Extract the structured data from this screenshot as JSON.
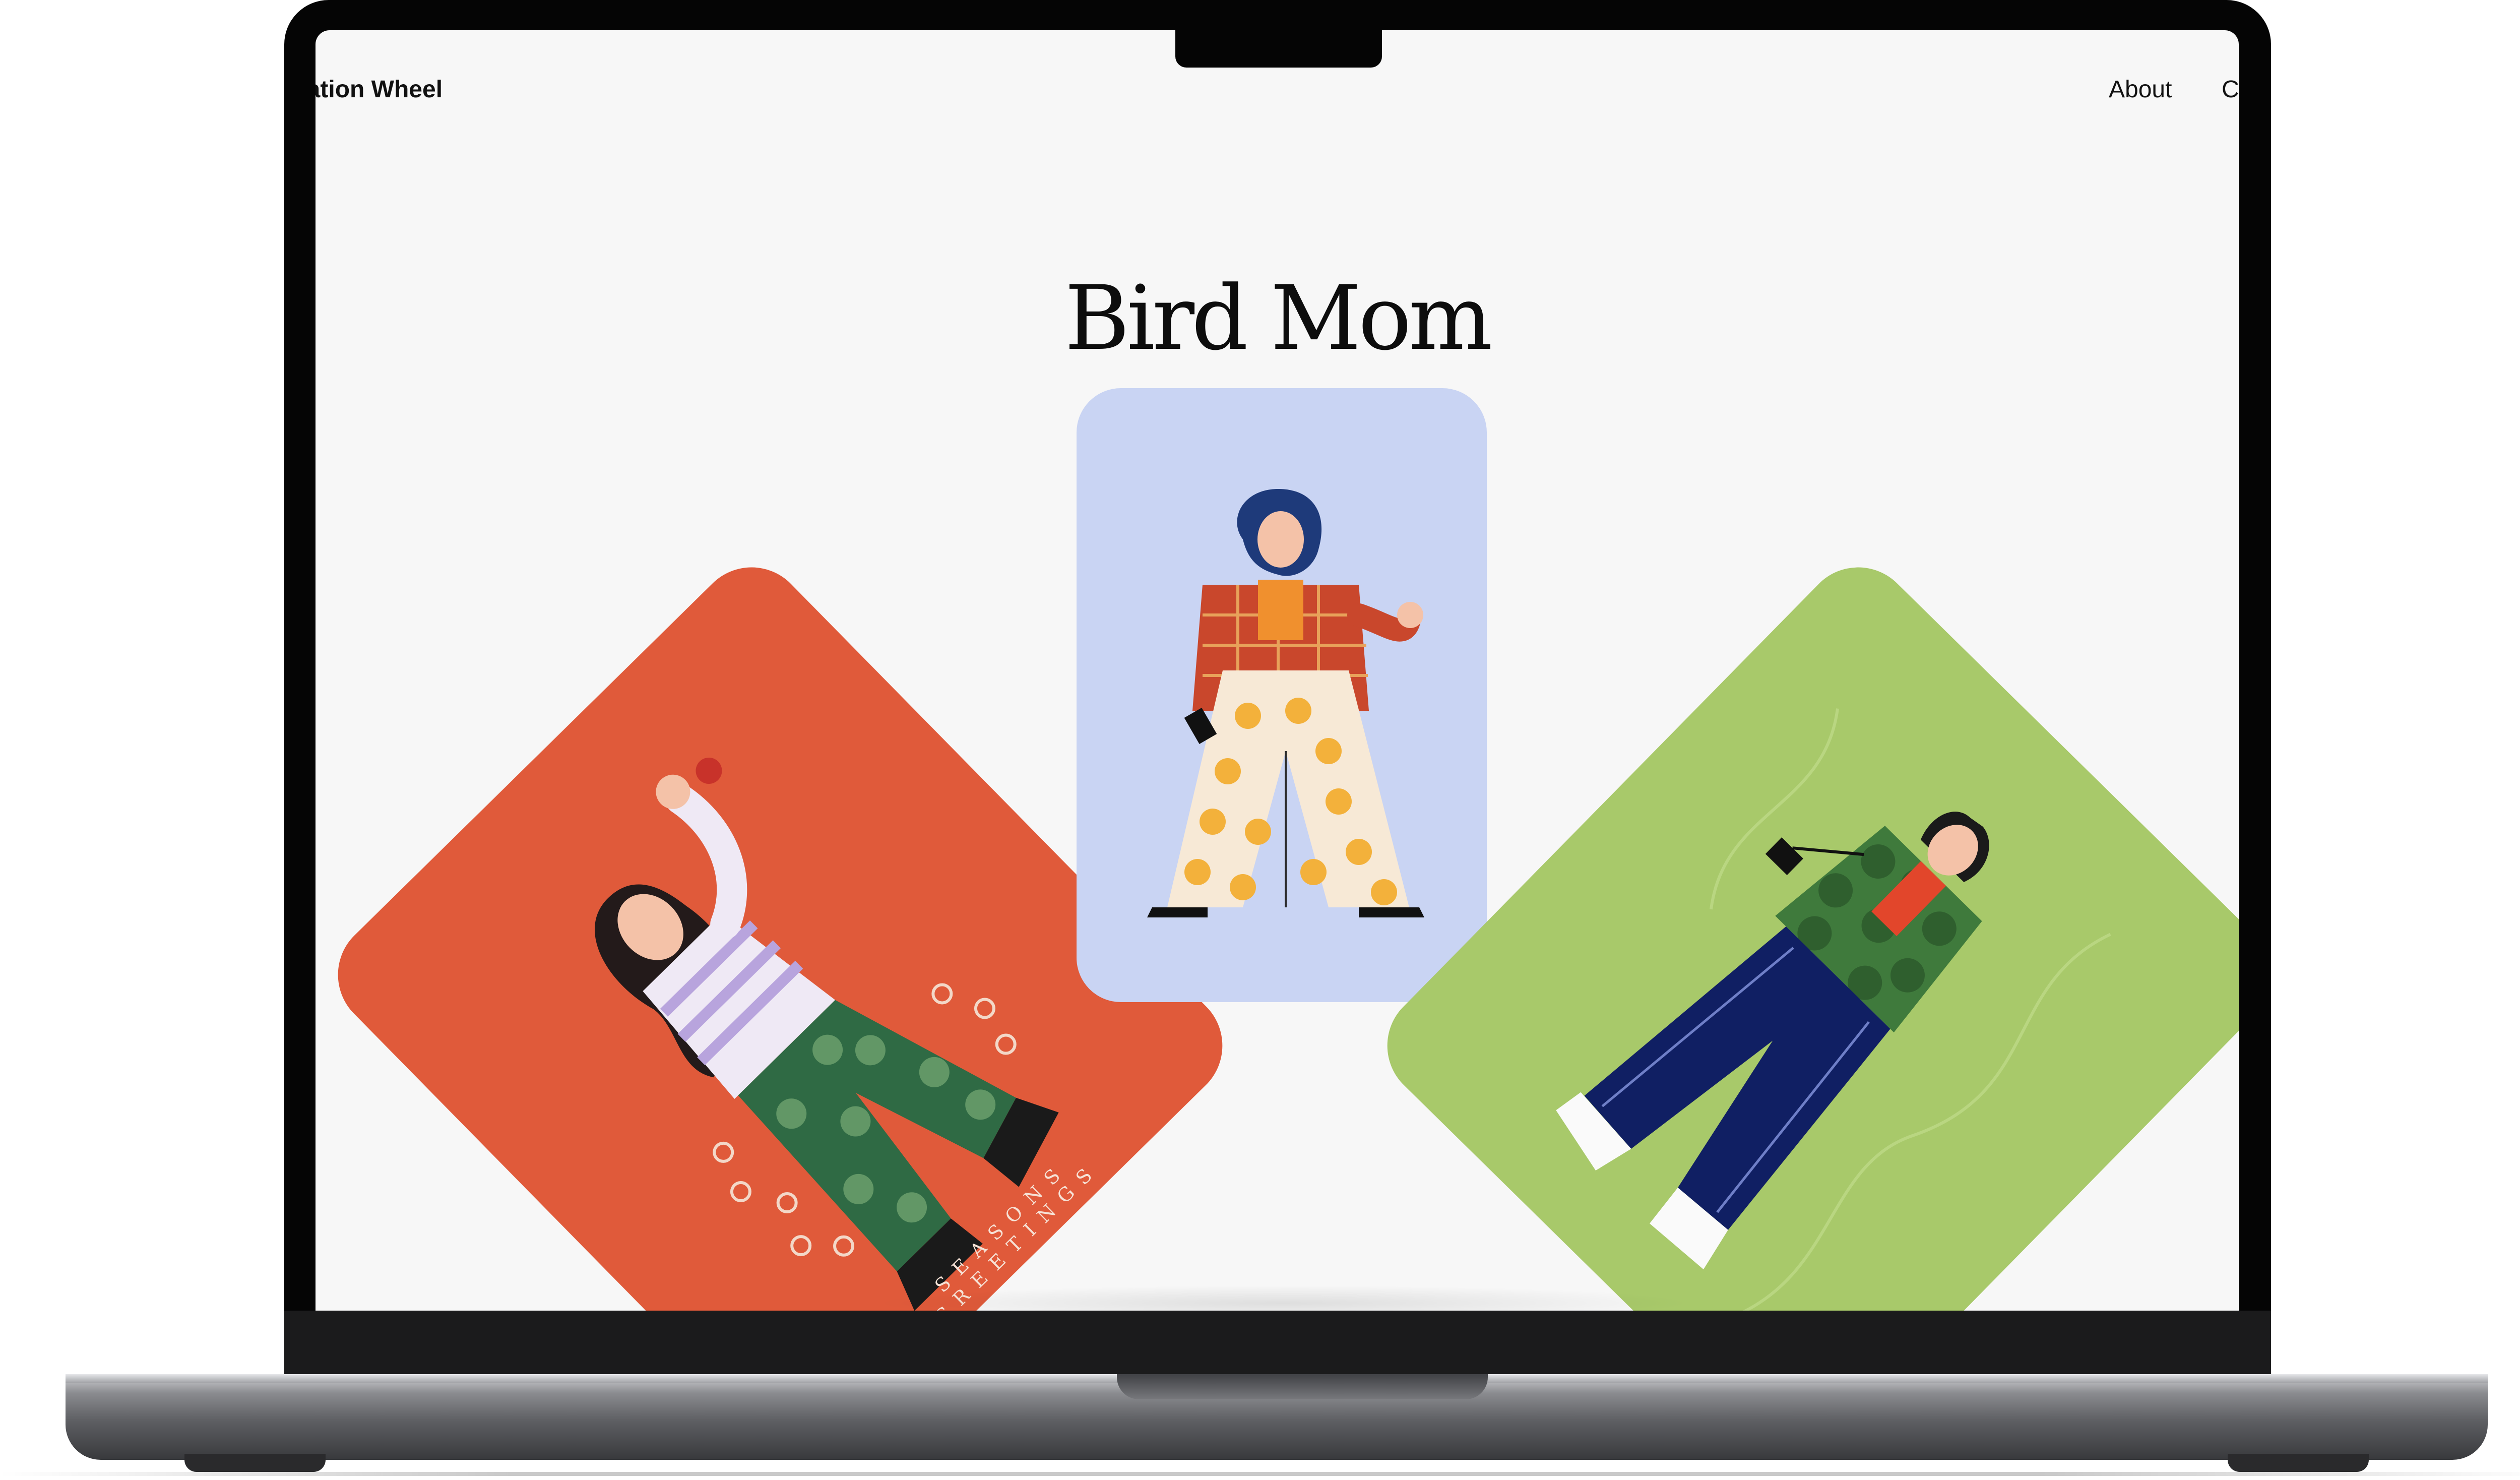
{
  "header": {
    "brand": "ration Wheel",
    "nav": [
      {
        "label": "About"
      },
      {
        "label": "C"
      }
    ]
  },
  "main": {
    "title": "Bird Mom",
    "cards": [
      {
        "name": "orange-card",
        "color": "#e05a3a",
        "caption": "SEASONS GREETINGS"
      },
      {
        "name": "blue-card",
        "color": "#c9d4f3",
        "caption": ""
      },
      {
        "name": "green-card",
        "color": "#a8c96a",
        "caption": ""
      }
    ]
  },
  "colors": {
    "screen_background": "#f7f7f7",
    "bezel": "#050505",
    "laptop_base": "#5d5e62"
  }
}
